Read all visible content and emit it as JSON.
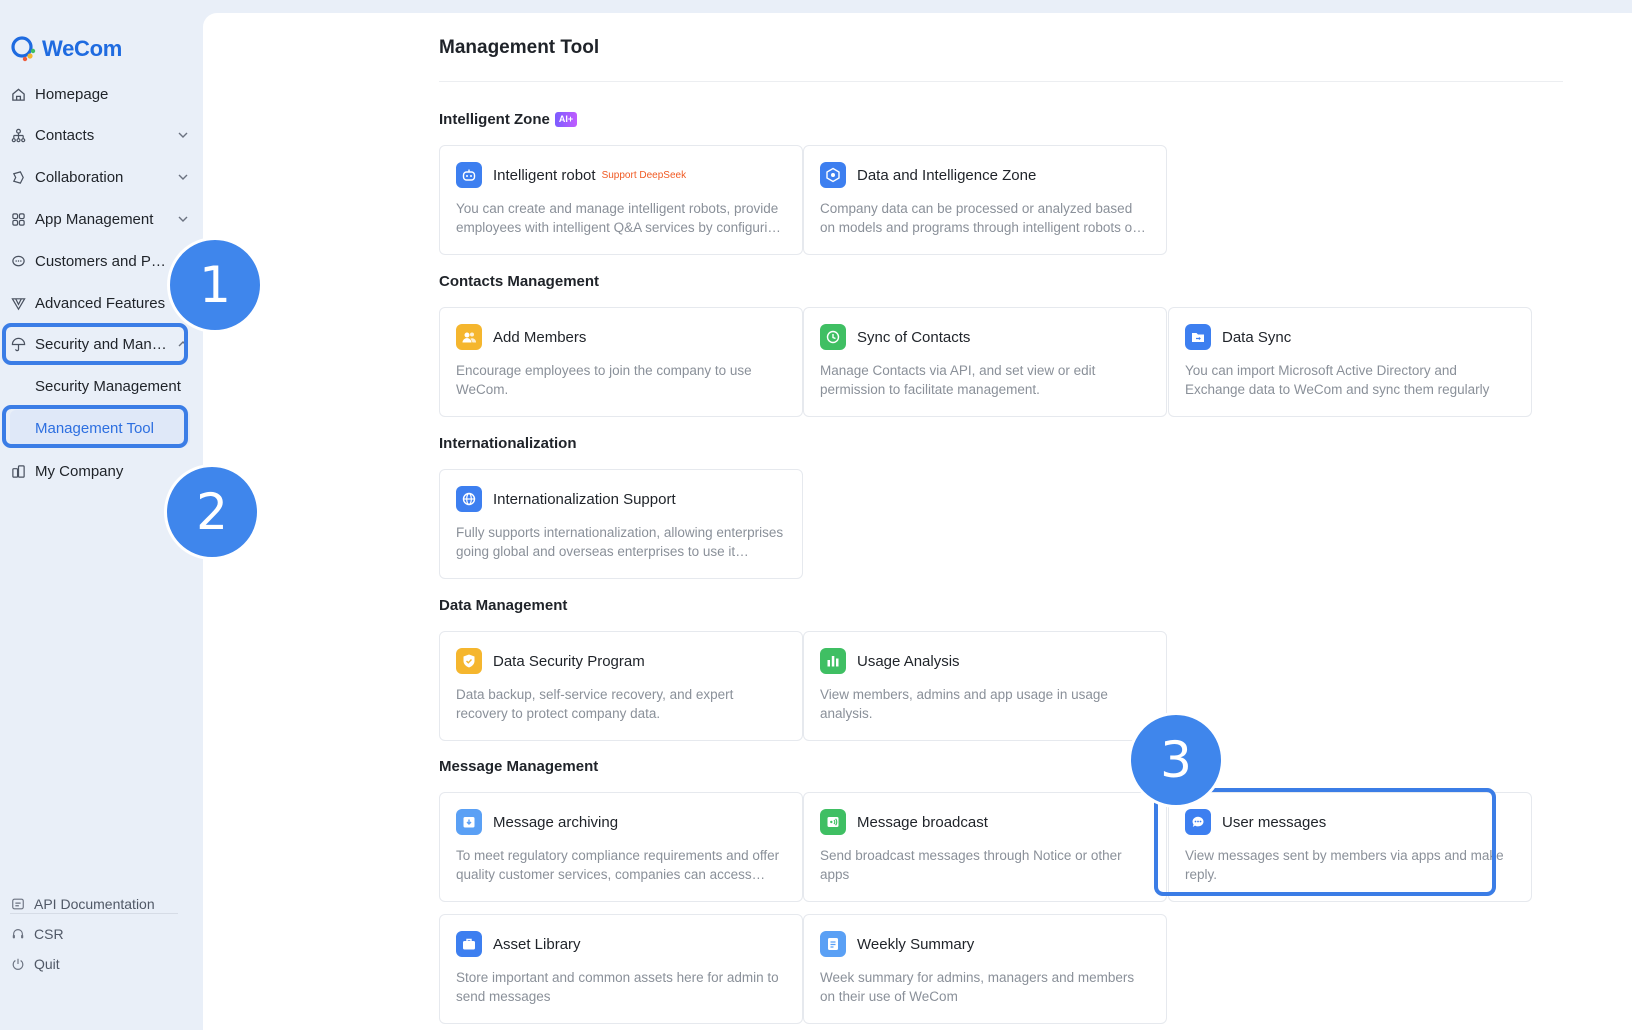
{
  "app": {
    "name": "WeCom"
  },
  "sidebar": {
    "items": [
      {
        "label": "Homepage",
        "icon": "home-icon"
      },
      {
        "label": "Contacts",
        "icon": "org-chart-icon"
      },
      {
        "label": "Collaboration",
        "icon": "collaboration-icon"
      },
      {
        "label": "App Management",
        "icon": "apps-grid-icon"
      },
      {
        "label": "Customers and P…",
        "icon": "chat-bubble-icon"
      },
      {
        "label": "Advanced Features",
        "icon": "vector-icon"
      },
      {
        "label": "Security and Man…",
        "icon": "umbrella-icon"
      },
      {
        "label": "My Company",
        "icon": "building-icon"
      }
    ],
    "sub_items": [
      {
        "label": "Security Management"
      },
      {
        "label": "Management Tool"
      }
    ],
    "footer": [
      {
        "label": "API Documentation",
        "icon": "document-icon"
      },
      {
        "label": "CSR",
        "icon": "headset-icon"
      },
      {
        "label": "Quit",
        "icon": "power-icon"
      }
    ]
  },
  "main": {
    "title": "Management Tool",
    "sections": [
      {
        "title": "Intelligent Zone",
        "badge": "AI+",
        "cards": [
          {
            "title": "Intelligent robot",
            "tag": "Support DeepSeek",
            "desc": "You can create and manage intelligent robots, provide employees with intelligent Q&A services by configuring knowledge bases",
            "icon": "robot-icon",
            "color": "#3d7ff0"
          },
          {
            "title": "Data and Intelligence Zone",
            "desc": "Company data can be processed or analyzed based on models and programs through intelligent robots or apps",
            "icon": "data-cube-icon",
            "color": "#3d7ff0"
          }
        ]
      },
      {
        "title": "Contacts Management",
        "cards": [
          {
            "title": "Add Members",
            "desc": "Encourage employees to join the company to use WeCom.",
            "icon": "add-members-icon",
            "color": "#f5b62e"
          },
          {
            "title": "Sync of Contacts",
            "desc": "Manage Contacts via API, and set view or edit permission to facilitate management.",
            "icon": "sync-icon",
            "color": "#3fbf63"
          },
          {
            "title": "Data Sync",
            "desc": "You can import Microsoft Active Directory and Exchange data to WeCom and sync them regularly",
            "icon": "folder-sync-icon",
            "color": "#3d7ff0"
          }
        ]
      },
      {
        "title": "Internationalization",
        "cards": [
          {
            "title": "Internationalization Support",
            "desc": "Fully supports internationalization, allowing enterprises going global and overseas enterprises to use it smoothly",
            "icon": "globe-icon",
            "color": "#3d7ff0"
          }
        ]
      },
      {
        "title": "Data Management",
        "cards": [
          {
            "title": "Data Security Program",
            "desc": "Data backup, self-service recovery, and expert recovery to protect company data.",
            "icon": "shield-icon",
            "color": "#f5b62e"
          },
          {
            "title": "Usage Analysis",
            "desc": "View members, admins and app usage in usage analysis.",
            "icon": "bar-chart-icon",
            "color": "#3fbf63"
          }
        ]
      },
      {
        "title": "Message Management",
        "cards": [
          {
            "title": "Message archiving",
            "desc": "To meet regulatory compliance requirements and offer quality customer services, companies can access archived messages",
            "icon": "archive-icon",
            "color": "#5aa0f5"
          },
          {
            "title": "Message broadcast",
            "desc": "Send broadcast messages through Notice or other apps",
            "icon": "broadcast-icon",
            "color": "#3fbf63"
          },
          {
            "title": "User messages",
            "desc": "View messages sent by members via apps and make reply.",
            "icon": "message-icon",
            "color": "#3d7ff0"
          }
        ]
      },
      {
        "title": "",
        "cards": [
          {
            "title": "Asset Library",
            "desc": "Store important and common assets here for admin to send messages",
            "icon": "briefcase-icon",
            "color": "#3d7ff0"
          },
          {
            "title": "Weekly Summary",
            "desc": "Week summary for admins, managers and members on their use of WeCom",
            "icon": "summary-icon",
            "color": "#5aa0f5"
          }
        ]
      }
    ]
  },
  "steps": [
    "1",
    "2",
    "3"
  ]
}
